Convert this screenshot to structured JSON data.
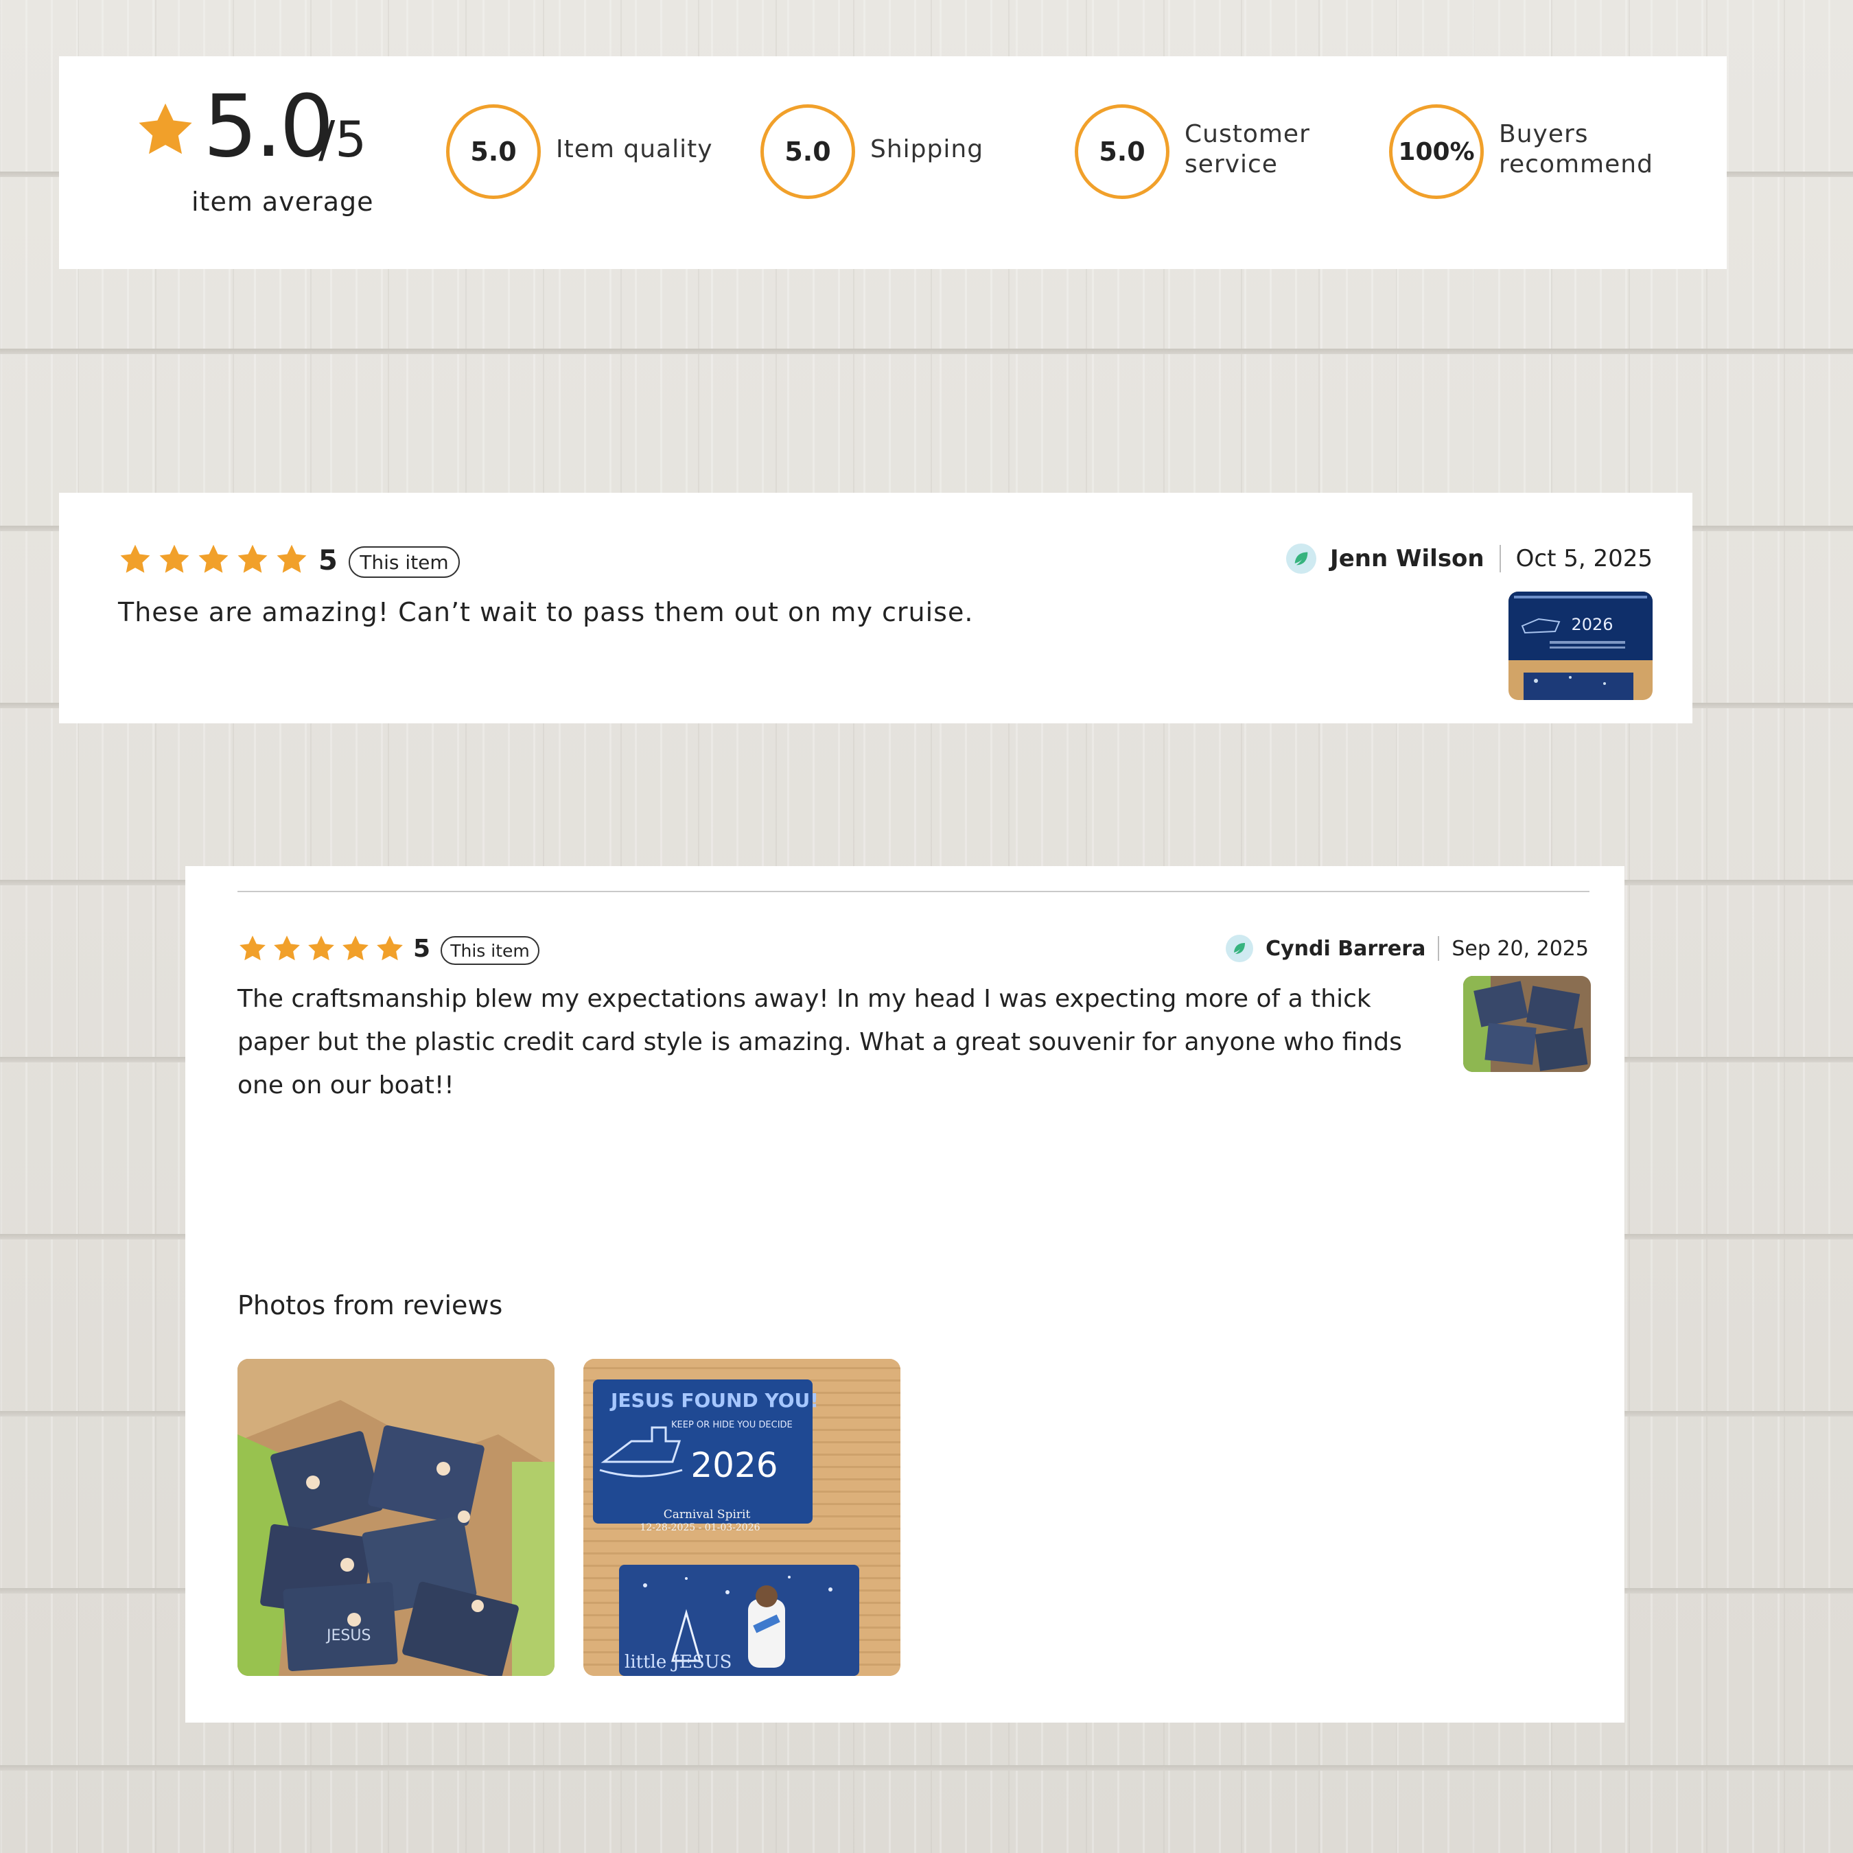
{
  "summary": {
    "average_value": "5.0",
    "average_denominator": "/5",
    "average_label": "item average",
    "average_rating": 5.0,
    "accent_color": "#f1a02a",
    "metrics": [
      {
        "value": "5.0",
        "label_line1": "Item quality",
        "label_line2": ""
      },
      {
        "value": "5.0",
        "label_line1": "Shipping",
        "label_line2": ""
      },
      {
        "value": "5.0",
        "label_line1": "Customer",
        "label_line2": "service"
      },
      {
        "value": "100%",
        "label_line1": "Buyers",
        "label_line2": "recommend"
      }
    ]
  },
  "reviews": [
    {
      "stars": 5,
      "rating_text": "5",
      "badge": "This item",
      "reviewer": "Jenn Wilson",
      "date": "Oct 5, 2025",
      "text": "These are amazing! Can’t wait to pass them out on my cruise.",
      "thumb_text": "2026",
      "avatar_icon": "leaf-avatar-icon"
    },
    {
      "stars": 5,
      "rating_text": "5",
      "badge": "This item",
      "reviewer": "Cyndi Barrera",
      "date": "Sep 20, 2025",
      "text_lines": [
        "The craftsmanship blew my expectations away! In my head I was expecting more of a thick",
        "paper but the plastic credit card style is amazing. What a great souvenir for anyone who finds",
        "one on our boat!!"
      ],
      "avatar_icon": "leaf-avatar-icon"
    }
  ],
  "photos_section": {
    "title": "Photos from reviews",
    "photo2": {
      "card_top": "JESUS FOUND YOU!",
      "card_sub": "KEEP OR HIDE YOU DECIDE",
      "year": "2026",
      "ship_name": "Carnival Spirit",
      "dates": "12-28-2025 - 01-03-2026",
      "card_bottom": "little JESUS"
    },
    "photo1": {
      "card_label": "JESUS"
    }
  },
  "icons": [
    "star-icon",
    "leaf-avatar-icon"
  ]
}
